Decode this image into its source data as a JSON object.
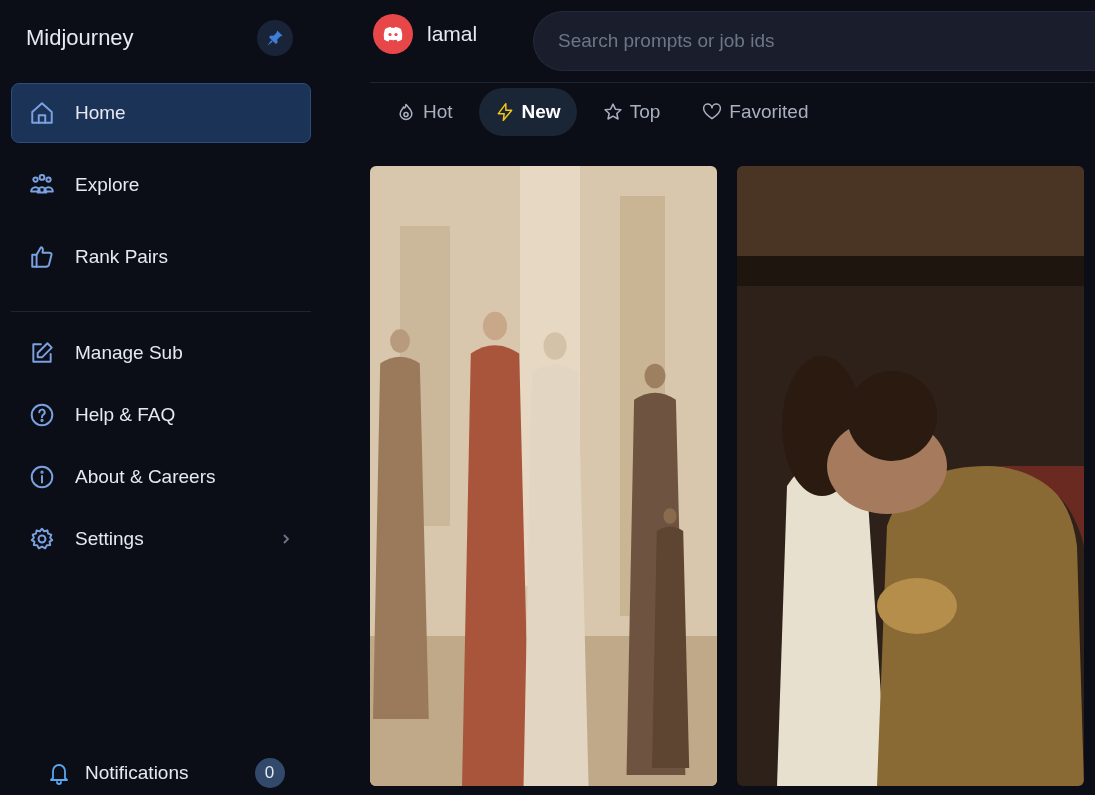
{
  "sidebar": {
    "title": "Midjourney",
    "primary_items": [
      {
        "label": "Home",
        "selected": true
      },
      {
        "label": "Explore",
        "selected": false
      },
      {
        "label": "Rank Pairs",
        "selected": false
      }
    ],
    "secondary_items": [
      {
        "label": "Manage Sub",
        "expandable": false
      },
      {
        "label": "Help & FAQ",
        "expandable": false
      },
      {
        "label": "About & Careers",
        "expandable": false
      },
      {
        "label": "Settings",
        "expandable": true
      }
    ],
    "notifications": {
      "label": "Notifications",
      "count": "0"
    }
  },
  "header": {
    "username": "lamal",
    "search": {
      "placeholder": "Search prompts or job ids"
    }
  },
  "tabs": [
    {
      "label": "Hot",
      "selected": false
    },
    {
      "label": "New",
      "selected": true
    },
    {
      "label": "Top",
      "selected": false
    },
    {
      "label": "Favorited",
      "selected": false
    }
  ]
}
